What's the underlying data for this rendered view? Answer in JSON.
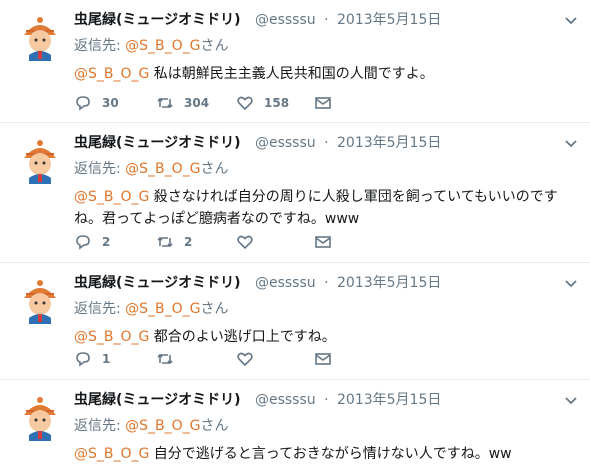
{
  "tweets": [
    {
      "name": "虫尾緑(ミュージオミドリ)",
      "handle": "@essssu",
      "date": "2013年5月15日",
      "reply_prefix": "返信先: ",
      "reply_to": "@S_B_O_G",
      "reply_suffix": "さん",
      "mention": "@S_B_O_G",
      "text": " 私は朝鮮民主主義人民共和国の人間ですよ。",
      "replies": "30",
      "retweets": "304",
      "likes": "158"
    },
    {
      "name": "虫尾緑(ミュージオミドリ)",
      "handle": "@essssu",
      "date": "2013年5月15日",
      "reply_prefix": "返信先: ",
      "reply_to": "@S_B_O_G",
      "reply_suffix": "さん",
      "mention": "@S_B_O_G",
      "text": " 殺さなければ自分の周りに人殺し軍団を飼っていてもいいのですね。君ってよっぽど臆病者なのですね。www",
      "replies": "2",
      "retweets": "2",
      "likes": ""
    },
    {
      "name": "虫尾緑(ミュージオミドリ)",
      "handle": "@essssu",
      "date": "2013年5月15日",
      "reply_prefix": "返信先: ",
      "reply_to": "@S_B_O_G",
      "reply_suffix": "さん",
      "mention": "@S_B_O_G",
      "text": " 都合のよい逃げ口上ですね。",
      "replies": "1",
      "retweets": "",
      "likes": ""
    },
    {
      "name": "虫尾緑(ミュージオミドリ)",
      "handle": "@essssu",
      "date": "2013年5月15日",
      "reply_prefix": "返信先: ",
      "reply_to": "@S_B_O_G",
      "reply_suffix": "さん",
      "mention": "@S_B_O_G",
      "text": " 自分で逃げると言っておきながら情けない人ですね。ww",
      "replies": "",
      "retweets": "",
      "likes": ""
    }
  ],
  "icons": {
    "reply": "reply-icon",
    "retweet": "retweet-icon",
    "like": "heart-icon",
    "dm": "envelope-icon",
    "menu": "chevron-down-icon"
  },
  "colors": {
    "mention": "#e0762c",
    "muted": "#657786",
    "divider": "#e6ecf0"
  }
}
